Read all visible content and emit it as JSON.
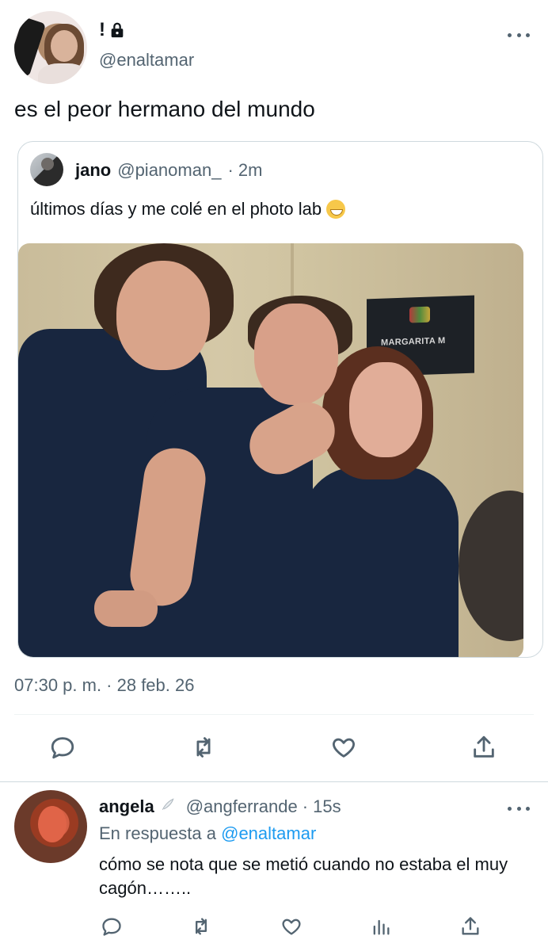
{
  "main_tweet": {
    "display_name": "!",
    "handle": "@enaltamar",
    "text": "es el peor hermano del mundo",
    "timestamp": "07:30 p. m. · 28 feb. 26"
  },
  "quoted_tweet": {
    "display_name": "jano",
    "handle": "@pianoman_",
    "time": "· 2m",
    "text": "últimos días y me colé en el photo lab",
    "emoji": "grinning-face",
    "photo_sign_text": "MARGARITA M"
  },
  "actions": [
    "reply-icon",
    "retweet-icon",
    "like-icon",
    "share-icon"
  ],
  "reply": {
    "display_name": "angela",
    "handle": "@angferrande",
    "time": "· 15s",
    "in_reply_prefix": "En respuesta a",
    "in_reply_mention": "@enaltamar",
    "text": "cómo se nota que se metió cuando no estaba el muy cagón……..",
    "actions": [
      "reply-icon",
      "retweet-icon",
      "like-icon",
      "views-icon",
      "share-icon"
    ]
  },
  "colors": {
    "text": "#0f1419",
    "secondary": "#536471",
    "link": "#1d9bf0",
    "border": "#cfd9de"
  }
}
